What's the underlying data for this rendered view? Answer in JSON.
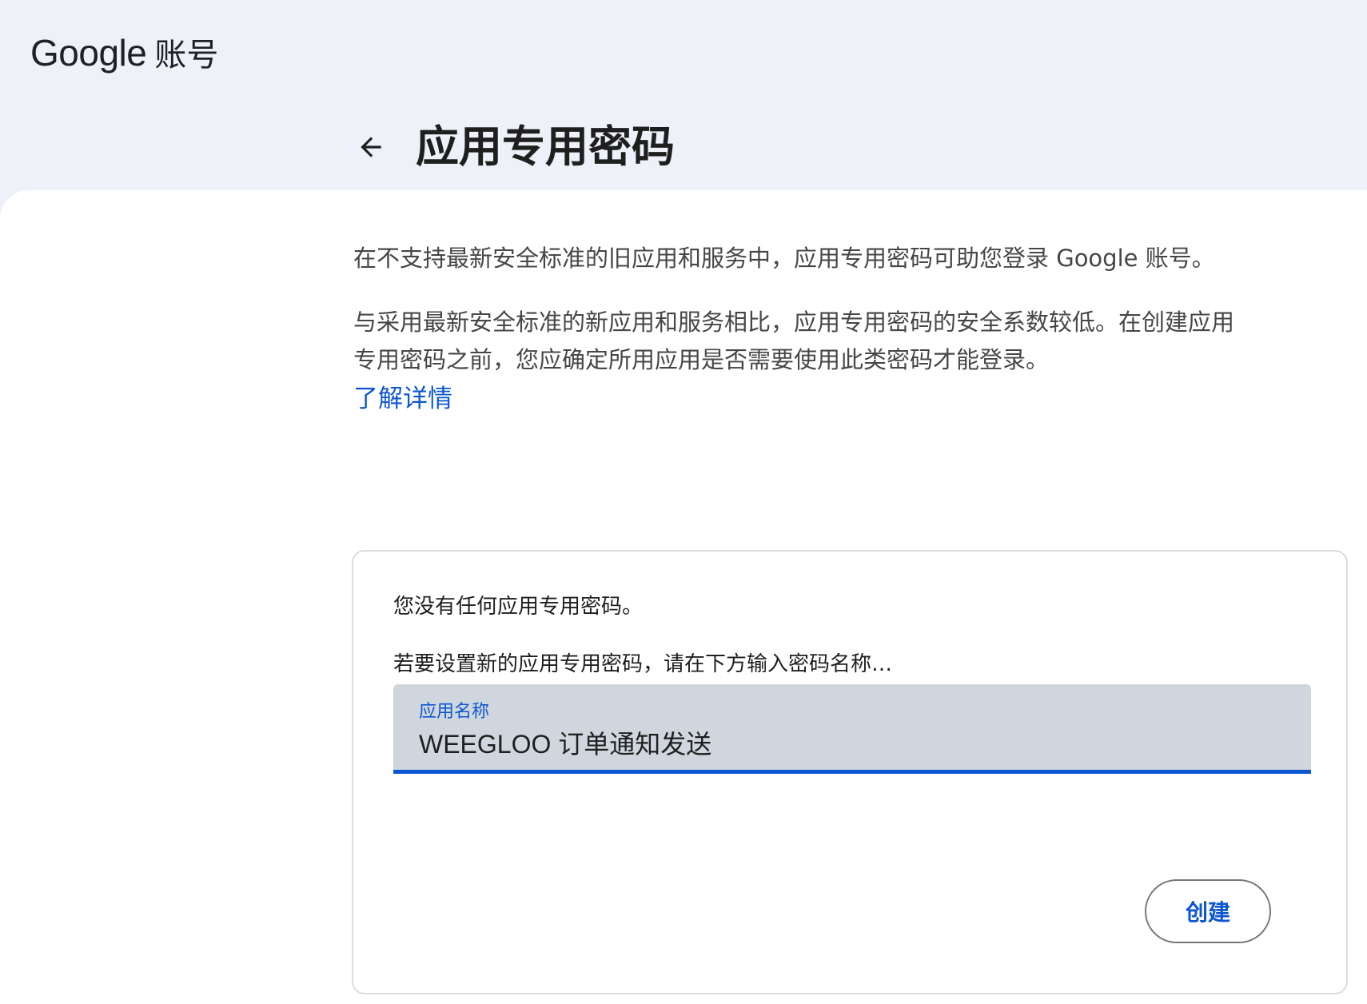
{
  "header": {
    "logo_google": "Google",
    "logo_account": "账号",
    "page_title": "应用专用密码"
  },
  "description": {
    "paragraph1": "在不支持最新安全标准的旧应用和服务中，应用专用密码可助您登录 Google 账号。",
    "paragraph2": "与采用最新安全标准的新应用和服务相比，应用专用密码的安全系数较低。在创建应用专用密码之前，您应确定所用应用是否需要使用此类密码才能登录。",
    "learn_more": "了解详情"
  },
  "card": {
    "no_passwords": "您没有任何应用专用密码。",
    "instruction": "若要设置新的应用专用密码，请在下方输入密码名称…",
    "field_label": "应用名称",
    "field_value": "WEEGLOO 订单通知发送",
    "create_label": "创建"
  },
  "colors": {
    "header_bg": "#eef2f8",
    "link": "#0b57d0",
    "field_bg": "#cfd6de"
  },
  "icons": {
    "back": "arrow-back-icon"
  }
}
